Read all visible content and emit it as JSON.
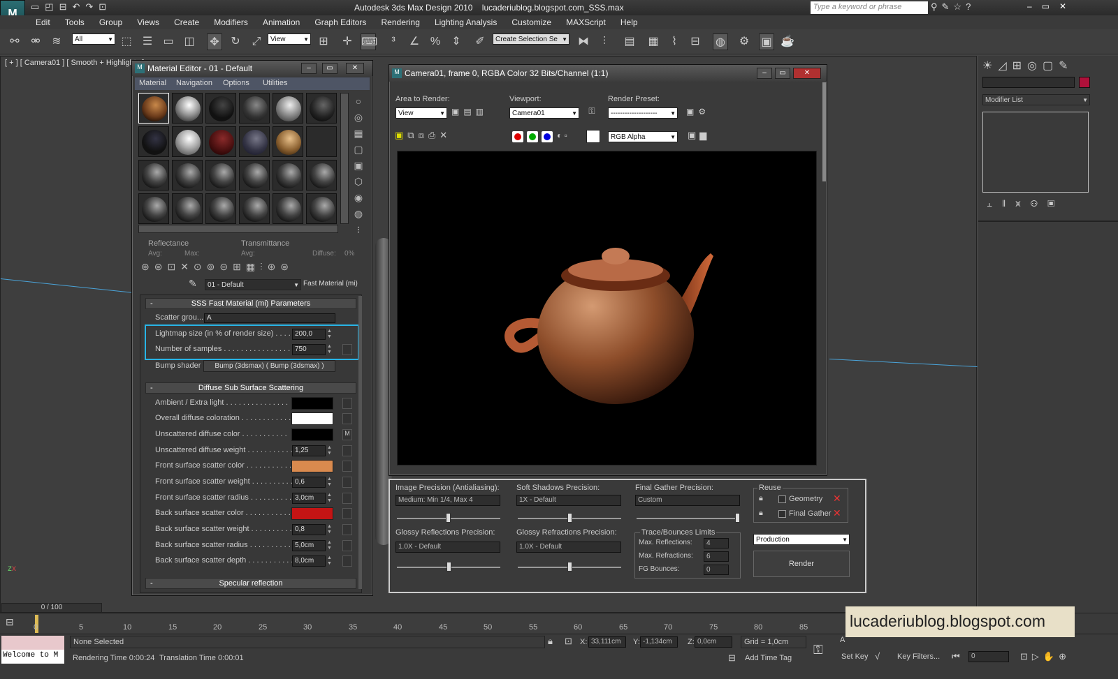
{
  "app": {
    "title": "Autodesk 3ds Max Design 2010",
    "file": "lucaderiublog.blogspot.com_SSS.max",
    "search_placeholder": "Type a keyword or phrase"
  },
  "menu": [
    "Edit",
    "Tools",
    "Group",
    "Views",
    "Create",
    "Modifiers",
    "Animation",
    "Graph Editors",
    "Rendering",
    "Lighting Analysis",
    "Customize",
    "MAXScript",
    "Help"
  ],
  "toolbar": {
    "filter": "All",
    "ref_coord": "View",
    "selection_set": "Create Selection Se"
  },
  "viewport": {
    "label": "[ + ] [ Camera01 ] [ Smooth + Highlights ]"
  },
  "material_editor": {
    "title": "Material Editor - 01 - Default",
    "menu": [
      "Material",
      "Navigation",
      "Options",
      "Utilities"
    ],
    "reflectance": "Reflectance",
    "transmittance": "Transmittance",
    "avg": "Avg:",
    "max": "Max:",
    "diffuse": "Diffuse:",
    "diffuse_val": "0%",
    "material_name": "01 - Default",
    "material_type": "Fast Material (mi)",
    "sss_section": "SSS Fast Material (mi) Parameters",
    "scatter_group_label": "Scatter grou...",
    "scatter_group_value": "A",
    "lightmap_label": "Lightmap size (in % of render size) . . . . . .",
    "lightmap_value": "200,0",
    "samples_label": "Number of samples . . . . . . . . . . . . . . . .",
    "samples_value": "750",
    "bump_label": "Bump shader . .",
    "bump_value": "Bump (3dsmax)  ( Bump (3dsmax) )",
    "diffuse_section": "Diffuse Sub Surface Scattering",
    "rows": [
      {
        "label": "Ambient / Extra light . . . . . . . . . . . . . . .",
        "swatch": "#000000"
      },
      {
        "label": "Overall diffuse coloration . . . . . . . . . . . .",
        "swatch": "#ffffff"
      },
      {
        "label": "Unscattered diffuse color . . . . . . . . . . .",
        "swatch": "#000000",
        "map": "M"
      },
      {
        "label": "Unscattered diffuse weight . . . . . . . . . . .",
        "value": "1,25"
      },
      {
        "label": "Front surface scatter color . . . . . . . . . . .",
        "swatch": "#d98a4e"
      },
      {
        "label": "Front surface scatter weight . . . . . . . . . .",
        "value": "0,6"
      },
      {
        "label": "Front surface scatter radius . . . . . . . . . .",
        "value": "3,0cm"
      },
      {
        "label": "Back surface scatter color . . . . . . . . . . .",
        "swatch": "#c41414"
      },
      {
        "label": "Back surface scatter weight . . . . . . . . . .",
        "value": "0,8"
      },
      {
        "label": "Back surface scatter radius . . . . . . . . . .",
        "value": "5,0cm"
      },
      {
        "label": "Back surface scatter depth . . . . . . . . . . .",
        "value": "8,0cm"
      }
    ],
    "specular_section": "Specular reflection"
  },
  "render_window": {
    "title": "Camera01, frame 0, RGBA Color 32 Bits/Channel (1:1)",
    "area_label": "Area to Render:",
    "area_value": "View",
    "viewport_label": "Viewport:",
    "viewport_value": "Camera01",
    "preset_label": "Render Preset:",
    "preset_value": "--------------------",
    "channel_value": "RGB Alpha"
  },
  "render_settings": {
    "image_precision_label": "Image Precision (Antialiasing):",
    "image_precision_value": "Medium: Min 1/4, Max 4",
    "soft_shadows_label": "Soft Shadows Precision:",
    "soft_shadows_value": "1X - Default",
    "final_gather_label": "Final Gather Precision:",
    "final_gather_value": "Custom",
    "glossy_refl_label": "Glossy Reflections Precision:",
    "glossy_refl_value": "1.0X - Default",
    "glossy_refr_label": "Glossy Refractions Precision:",
    "glossy_refr_value": "1.0X - Default",
    "trace_label": "Trace/Bounces Limits",
    "max_refl_label": "Max. Reflections:",
    "max_refl_value": "4",
    "max_refr_label": "Max. Refractions:",
    "max_refr_value": "6",
    "fg_bounces_label": "FG Bounces:",
    "fg_bounces_value": "0",
    "reuse_label": "Reuse",
    "geometry_label": "Geometry",
    "final_gather_chk_label": "Final Gather",
    "production_value": "Production",
    "render_button": "Render"
  },
  "command_panel": {
    "modifier_list": "Modifier List"
  },
  "timeline": {
    "frame": "0 / 100",
    "ticks": [
      "0",
      "5",
      "10",
      "15",
      "20",
      "25",
      "30",
      "35",
      "40",
      "45",
      "50",
      "55",
      "60",
      "65",
      "70",
      "75",
      "80",
      "85"
    ]
  },
  "status": {
    "maxscript": "Welcome to M",
    "selection": "None Selected",
    "render_time": "Rendering Time 0:00:24",
    "translation_time": "Translation Time 0:00:01",
    "x_label": "X:",
    "x_value": "33,111cm",
    "y_label": "Y:",
    "y_value": "-1,134cm",
    "z_label": "Z:",
    "z_value": "0,0cm",
    "grid": "Grid = 1,0cm",
    "add_time_tag": "Add Time Tag",
    "set_key": "Set Key",
    "key_filters": "Key Filters...",
    "frame_field": "0",
    "auto_key": "A"
  },
  "watermark": "lucaderiublog.blogspot.com"
}
